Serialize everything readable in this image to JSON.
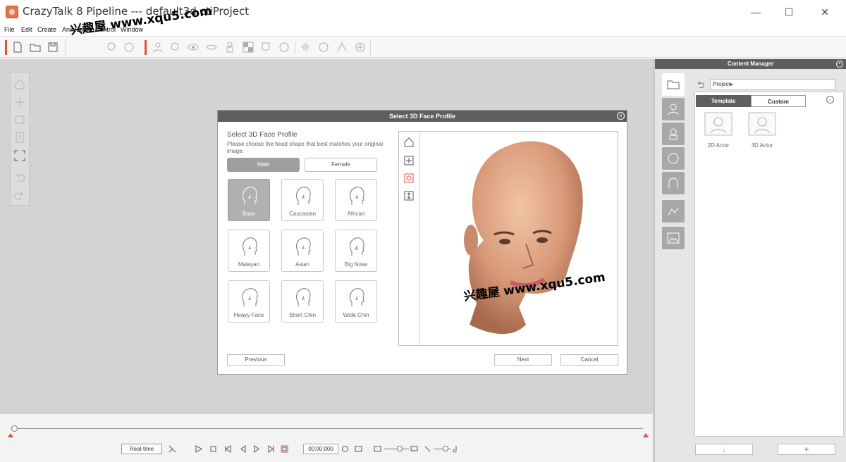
{
  "window": {
    "title": "CrazyTalk 8 Pipeline --- default3d.ctiProject",
    "minimize": "—",
    "maximize": "☐",
    "close": "✕"
  },
  "menu": [
    "File",
    "Edit",
    "Create",
    "Animation",
    "Control",
    "Window"
  ],
  "watermark": "兴趣屋 www.xqu5.com",
  "dialog": {
    "title": "Select 3D Face Profile",
    "heading": "Select 3D Face Profile",
    "description": "Please choose the head shape that best matches your original image.",
    "gender": {
      "male": "Male",
      "female": "Female",
      "selected": "Male"
    },
    "shapes": [
      "Base",
      "Caucasian",
      "African",
      "Malayan",
      "Asian",
      "Big Nose",
      "Heavy Face",
      "Short Chin",
      "Wide Chin"
    ],
    "selected_shape": "Base",
    "previous": "Previous",
    "next": "Next",
    "cancel": "Cancel"
  },
  "timeline": {
    "realtime": "Real-time",
    "timecode": "00:00:000"
  },
  "content_manager": {
    "title": "Content Manager",
    "path": "Project",
    "tabs": [
      "Template",
      "Custom"
    ],
    "active_tab": "Template",
    "items": [
      "2D Actor",
      "3D Actor"
    ],
    "down_btn": "↓",
    "add_btn": "+"
  },
  "colors": {
    "accent_red": "#e84c3d",
    "header_gray": "#5e5e5e"
  }
}
